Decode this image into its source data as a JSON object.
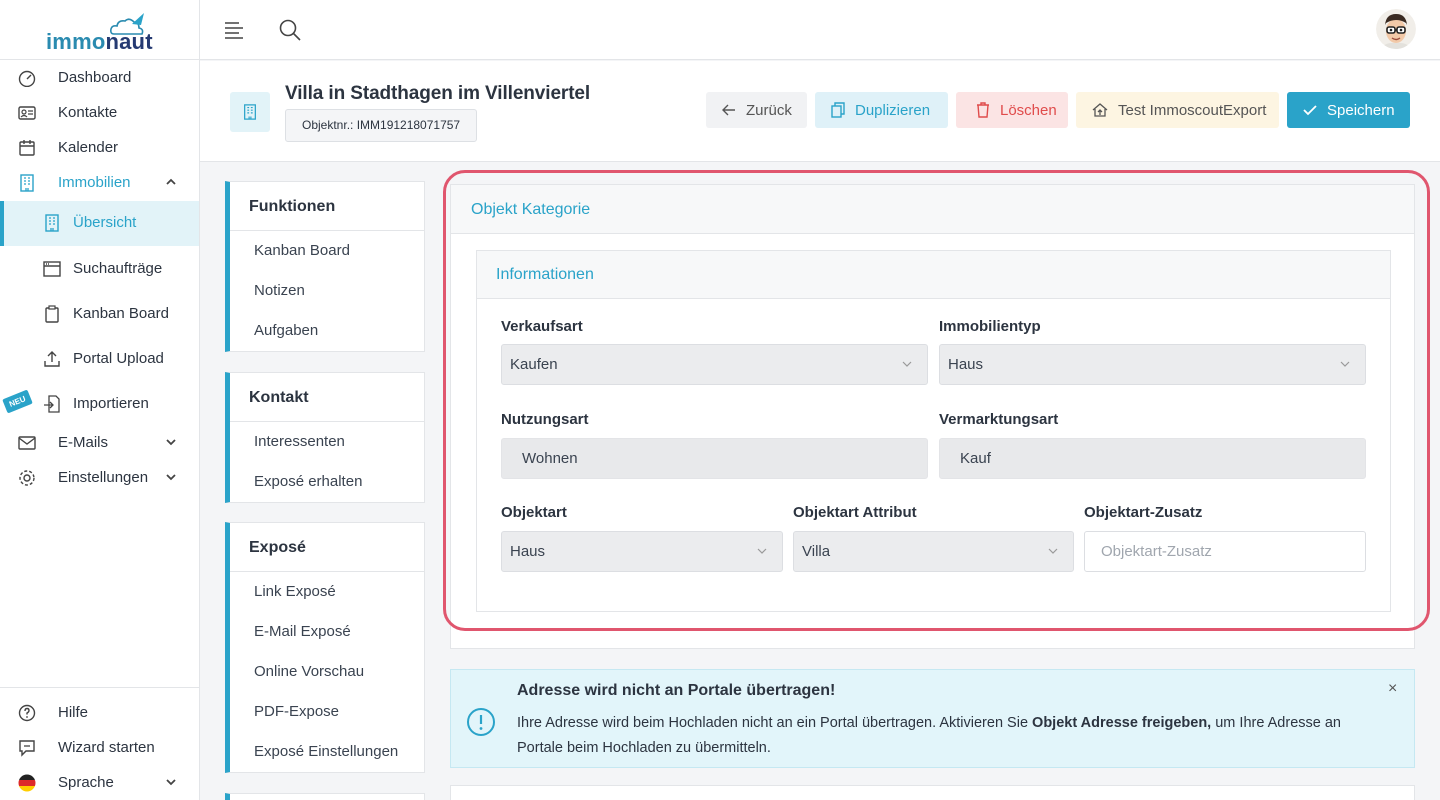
{
  "app": {
    "logo_text_1": "immo",
    "logo_text_2": "naut"
  },
  "sidebar": {
    "items": [
      {
        "label": "Dashboard",
        "icon": "speedometer-icon"
      },
      {
        "label": "Kontakte",
        "icon": "contact-card-icon"
      },
      {
        "label": "Kalender",
        "icon": "calendar-icon"
      },
      {
        "label": "Immobilien",
        "icon": "building-icon"
      },
      {
        "label": "Übersicht",
        "icon": "building-icon"
      },
      {
        "label": "Suchaufträge",
        "icon": "browser-window-icon"
      },
      {
        "label": "Kanban Board",
        "icon": "clipboard-icon"
      },
      {
        "label": "Portal Upload",
        "icon": "upload-icon"
      },
      {
        "label": "Importieren",
        "icon": "import-icon"
      },
      {
        "label": "E-Mails",
        "icon": "mail-icon"
      },
      {
        "label": "Einstellungen",
        "icon": "gear-icon"
      }
    ],
    "badge": "NEU",
    "footer": [
      {
        "label": "Hilfe",
        "icon": "help-circle-icon"
      },
      {
        "label": "Wizard starten",
        "icon": "chat-icon"
      },
      {
        "label": "Sprache",
        "icon": "german-flag-icon"
      }
    ]
  },
  "header": {
    "title": "Villa in Stadthagen im Villenviertel",
    "object_number": "Objektnr.: IMM191218071757",
    "buttons": {
      "back": "Zurück",
      "duplicate": "Duplizieren",
      "delete": "Löschen",
      "test_export": "Test ImmoscoutExport",
      "save": "Speichern"
    }
  },
  "left_cards": [
    {
      "title": "Funktionen",
      "items": [
        "Kanban Board",
        "Notizen",
        "Aufgaben"
      ]
    },
    {
      "title": "Kontakt",
      "items": [
        "Interessenten",
        "Exposé erhalten"
      ]
    },
    {
      "title": "Exposé",
      "items": [
        "Link Exposé",
        "E-Mail Exposé",
        "Online Vorschau",
        "PDF-Expose",
        "Exposé Einstellungen"
      ]
    }
  ],
  "category": {
    "title": "Objekt Kategorie",
    "section_title": "Informationen",
    "fields": {
      "verkaufsart": {
        "label": "Verkaufsart",
        "value": "Kaufen"
      },
      "immobilientyp": {
        "label": "Immobilientyp",
        "value": "Haus"
      },
      "nutzungsart": {
        "label": "Nutzungsart",
        "value": "Wohnen"
      },
      "vermarktungsart": {
        "label": "Vermarktungsart",
        "value": "Kauf"
      },
      "objektart": {
        "label": "Objektart",
        "value": "Haus"
      },
      "objektart_attribut": {
        "label": "Objektart Attribut",
        "value": "Villa"
      },
      "objektart_zusatz": {
        "label": "Objektart-Zusatz",
        "placeholder": "Objektart-Zusatz"
      }
    }
  },
  "alert": {
    "title": "Adresse wird nicht an Portale übertragen!",
    "body_1": "Ihre Adresse wird beim Hochladen nicht an ein Portal übertragen. Aktivieren Sie ",
    "body_bold": "Objekt Adresse freigeben,",
    "body_2": " um Ihre Adresse an Portale beim Hochladen zu übermitteln.",
    "close": "×"
  },
  "colors": {
    "accent": "#2aa3c9",
    "highlight": "#e0566e",
    "danger": "#e04b4b"
  }
}
